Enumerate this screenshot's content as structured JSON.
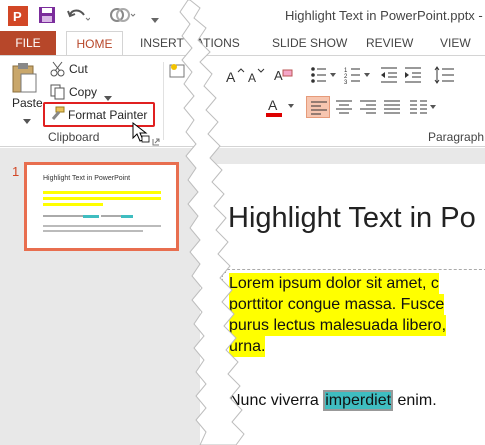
{
  "window": {
    "title": "Highlight Text in PowerPoint.pptx - Po"
  },
  "tabs": [
    "FILE",
    "HOME",
    "INSERT",
    "ATIONS",
    "SLIDE SHOW",
    "REVIEW",
    "VIEW"
  ],
  "clipboard": {
    "paste": "Paste",
    "cut": "Cut",
    "copy": "Copy",
    "format_painter": "Format Painter",
    "group_label": "Clipboard"
  },
  "paragraph": {
    "group_label": "Paragraph"
  },
  "slides_panel": {
    "slide_number": "1",
    "thumb_title": "Highlight Text in PowerPoint"
  },
  "slide": {
    "title": "Highlight Text in Po",
    "lines": [
      "Lorem ipsum dolor sit amet, c",
      "porttitor congue massa. Fusce",
      "purus lectus malesuada libero,",
      "urna."
    ],
    "line2_pre": "Nunc viverra ",
    "line2_hl": "imperdiet",
    "line2_post": " enim."
  },
  "colors": {
    "accent": "#b7472a",
    "highlight_yellow": "#ffff00",
    "highlight_teal": "#3fbdc0",
    "callout_red": "#e02020"
  }
}
